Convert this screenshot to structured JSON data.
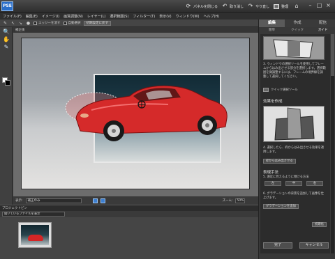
{
  "app": {
    "logo": "PSE"
  },
  "titlebar": {
    "panel_toggle_label": "パネルを閉じる",
    "undo_label": "取り消し",
    "redo_label": "やり直し",
    "organize_label": "整理",
    "home_icon": "home-icon"
  },
  "menu": [
    "ファイル(F)",
    "編集(E)",
    "イメージ(I)",
    "画質調整(N)",
    "レイヤー(L)",
    "選択範囲(S)",
    "フィルター(T)",
    "表示(V)",
    "ウィンドウ(W)",
    "ヘルプ(H)"
  ],
  "options": {
    "check_1": "エッジーを消す",
    "check_2": "自動選択",
    "reset_label": "初期設定に戻す"
  },
  "document": {
    "tab_title": "補正後"
  },
  "status": {
    "view_label": "表示:",
    "view_value": "補正のみ",
    "zoom_label": "ズーム:",
    "zoom_value": "50%"
  },
  "bin": {
    "header": "プロジェクトビン",
    "select_value": "開いているファイルを表示"
  },
  "rpanel": {
    "tabs": [
      "編集",
      "作成",
      "配信"
    ],
    "subtabs": [
      "簡単",
      "クイック",
      "ガイド"
    ],
    "step1_text": "3. ウィンドウの選択ツールを使用してフレームからはみ出させる部分を選択します。選択範囲を微調整するには、フレームの境界線を調整して選択してください。",
    "tool_button": "クイック選択ツール",
    "section_effect": "効果を作成",
    "step4_text": "4. 選択したら、枠からはみ出させる効果を適用します。",
    "effect_button": "枠からはみ出させる",
    "section_style": "表現手法",
    "step5_text": "5. 遠近に見えるように傾ける方法",
    "seg_buttons": [
      "左",
      "中",
      "右"
    ],
    "step6_text": "6. グラデーションの背景を追加して画像を仕上げます。",
    "gradient_button": "グラデーションを追加",
    "reset_button": "初期化",
    "done_button": "完了",
    "cancel_button": "キャンセル"
  }
}
